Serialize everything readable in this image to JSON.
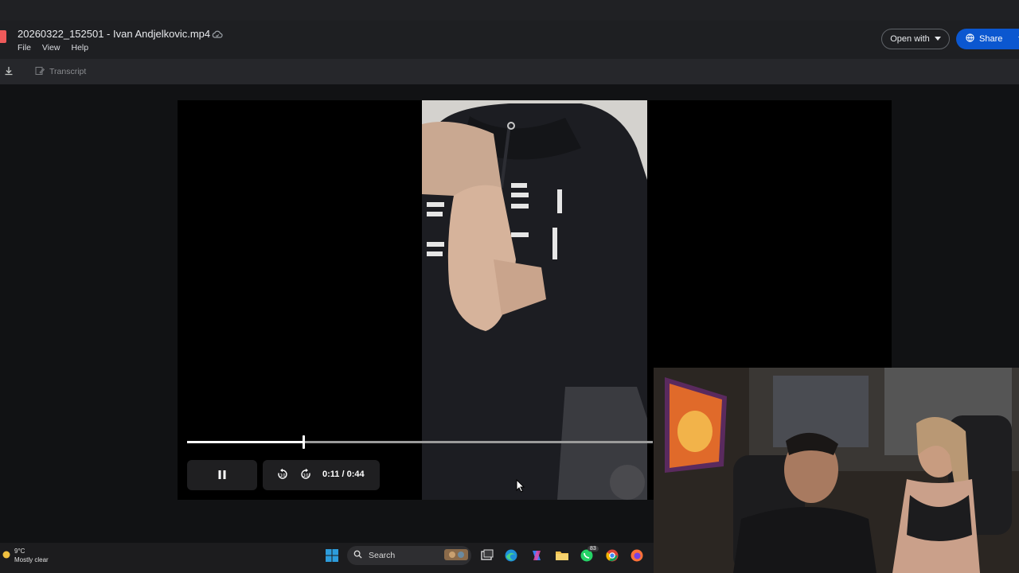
{
  "window": {
    "file_name": "20260322_152501 - Ivan Andjelkovic.mp4"
  },
  "menu": [
    "File",
    "View",
    "Help"
  ],
  "actions": {
    "open_with_label": "Open with",
    "share_label": "Share"
  },
  "toolbar": {
    "transcript_label": "Transcript"
  },
  "player": {
    "progress": 0.25,
    "time_current": "0:11",
    "time_total": "/ 0:44"
  },
  "taskbar": {
    "weather_temp": "9°C",
    "weather_desc": "Mostly clear",
    "search_label": "Search",
    "whatsapp_badge": "83"
  },
  "colors": {
    "share_blue": "#0b57d0",
    "background": "#111214"
  }
}
